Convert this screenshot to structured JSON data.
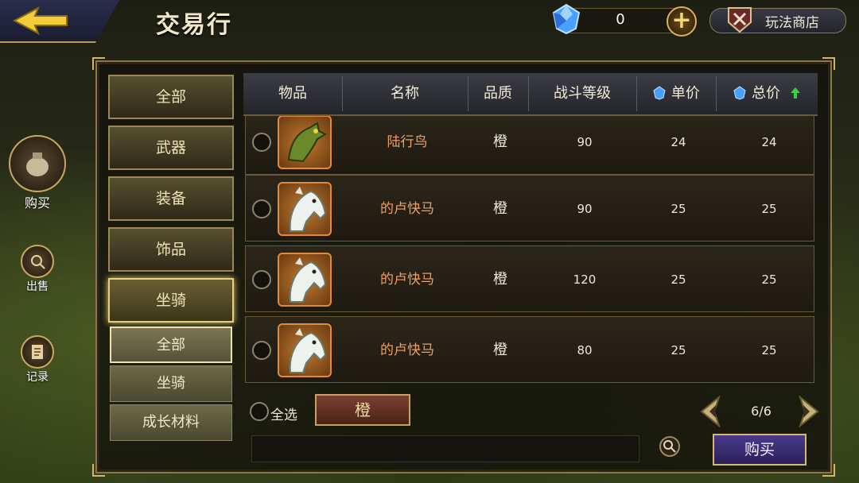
{
  "header": {
    "title": "交易行",
    "gem_count": "0",
    "shop_label": "玩法商店",
    "icons": {
      "back": "back-arrow-icon",
      "gem": "blue-diamond-icon",
      "plus": "plus-icon",
      "shop": "shop-emblem-icon"
    }
  },
  "side_nav": {
    "buy_label": "购买",
    "sell_label": "出售",
    "record_label": "记录"
  },
  "categories": [
    "全部",
    "武器",
    "装备",
    "饰品",
    "坐骑"
  ],
  "active_category": "坐骑",
  "subcategories": [
    "全部",
    "坐骑",
    "成长材料"
  ],
  "active_subcategory": "全部",
  "table": {
    "headers": {
      "item": "物品",
      "name": "名称",
      "quality": "品质",
      "level": "战斗等级",
      "unit_price": "单价",
      "total_price": "总价"
    },
    "rows": [
      {
        "name": "陆行鸟",
        "quality": "橙",
        "level": "90",
        "unit_price": "24",
        "total_price": "24",
        "icon": "dragon-mount-icon"
      },
      {
        "name": "的卢快马",
        "quality": "橙",
        "level": "90",
        "unit_price": "25",
        "total_price": "25",
        "icon": "white-horse-icon"
      },
      {
        "name": "的卢快马",
        "quality": "橙",
        "level": "120",
        "unit_price": "25",
        "total_price": "25",
        "icon": "white-horse-icon"
      },
      {
        "name": "的卢快马",
        "quality": "橙",
        "level": "80",
        "unit_price": "25",
        "total_price": "25",
        "icon": "white-horse-icon"
      }
    ]
  },
  "footer": {
    "select_all_label": "全选",
    "quality_filter": "橙",
    "page": "6/6",
    "buy_button": "购买"
  },
  "colors": {
    "accent_gold": "#d4b46a",
    "quality_orange": "#f0a060",
    "buy_purple": "#4a3a8a"
  }
}
